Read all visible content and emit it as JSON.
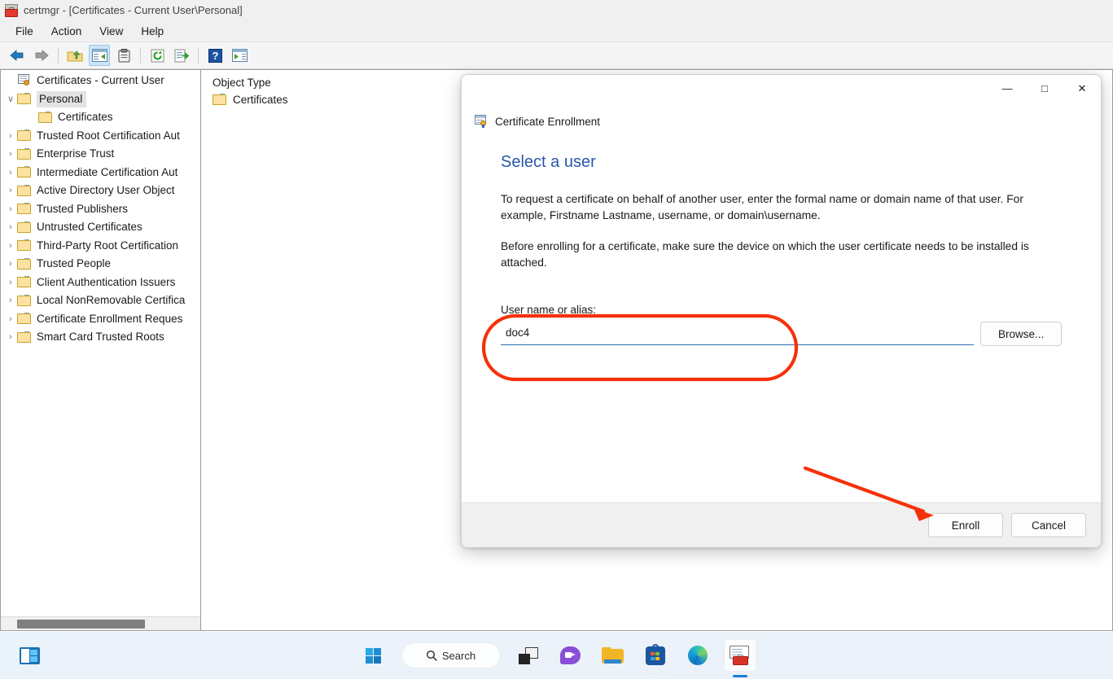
{
  "window": {
    "title": "certmgr - [Certificates - Current User\\Personal]",
    "icon": "certmgr-toolbox-icon",
    "menu": [
      "File",
      "Action",
      "View",
      "Help"
    ],
    "toolbar_buttons": [
      {
        "name": "back-arrow-icon",
        "label": "Back"
      },
      {
        "name": "forward-arrow-icon",
        "label": "Forward"
      },
      {
        "name": "up-one-level-icon",
        "label": "Up One Level"
      },
      {
        "name": "show-hide-console-tree-icon",
        "label": "Show/Hide Console Tree"
      },
      {
        "name": "properties-icon",
        "label": "Properties"
      },
      {
        "name": "refresh-icon",
        "label": "Refresh"
      },
      {
        "name": "export-list-icon",
        "label": "Export List"
      },
      {
        "name": "help-icon",
        "label": "Help"
      },
      {
        "name": "show-action-pane-icon",
        "label": "Show/Hide Action Pane"
      }
    ]
  },
  "tree": {
    "root": "Certificates - Current User",
    "items": [
      {
        "label": "Personal",
        "indent": 1,
        "expanded": true,
        "selected": true,
        "chevron": "∨"
      },
      {
        "label": "Certificates",
        "indent": 2,
        "expanded": false,
        "selected": false,
        "chevron": ""
      },
      {
        "label": "Trusted Root Certification Aut",
        "indent": 1,
        "expanded": false,
        "selected": false,
        "chevron": "›"
      },
      {
        "label": "Enterprise Trust",
        "indent": 1,
        "expanded": false,
        "selected": false,
        "chevron": "›"
      },
      {
        "label": "Intermediate Certification Aut",
        "indent": 1,
        "expanded": false,
        "selected": false,
        "chevron": "›"
      },
      {
        "label": "Active Directory User Object",
        "indent": 1,
        "expanded": false,
        "selected": false,
        "chevron": "›"
      },
      {
        "label": "Trusted Publishers",
        "indent": 1,
        "expanded": false,
        "selected": false,
        "chevron": "›"
      },
      {
        "label": "Untrusted Certificates",
        "indent": 1,
        "expanded": false,
        "selected": false,
        "chevron": "›"
      },
      {
        "label": "Third-Party Root Certification",
        "indent": 1,
        "expanded": false,
        "selected": false,
        "chevron": "›"
      },
      {
        "label": "Trusted People",
        "indent": 1,
        "expanded": false,
        "selected": false,
        "chevron": "›"
      },
      {
        "label": "Client Authentication Issuers",
        "indent": 1,
        "expanded": false,
        "selected": false,
        "chevron": "›"
      },
      {
        "label": "Local NonRemovable Certifica",
        "indent": 1,
        "expanded": false,
        "selected": false,
        "chevron": "›"
      },
      {
        "label": "Certificate Enrollment Reques",
        "indent": 1,
        "expanded": false,
        "selected": false,
        "chevron": "›"
      },
      {
        "label": "Smart Card Trusted Roots",
        "indent": 1,
        "expanded": false,
        "selected": false,
        "chevron": "›"
      }
    ]
  },
  "list": {
    "column_header": "Object Type",
    "rows": [
      {
        "label": "Certificates"
      }
    ]
  },
  "dialog": {
    "app_title": "Certificate Enrollment",
    "heading": "Select a user",
    "paragraphs": [
      "To request a certificate on behalf of another user, enter the formal name or domain name of that user. For example, Firstname Lastname, username, or domain\\username.",
      "Before enrolling for a certificate, make sure the device on which the user certificate needs to be installed is attached."
    ],
    "field": {
      "label": "User name or alias:",
      "value": "doc4",
      "placeholder": ""
    },
    "browse_label": "Browse...",
    "enroll_label": "Enroll",
    "cancel_label": "Cancel",
    "window_controls": {
      "minimize": "—",
      "maximize": "□",
      "close": "✕"
    }
  },
  "annotations": {
    "highlight_color": "#f5310a",
    "ellipse_target": "User name or alias field",
    "arrow_target": "Enroll button"
  },
  "taskbar": {
    "left_icon": "widgets-icon",
    "search_label": "Search",
    "items": [
      {
        "name": "start-button",
        "label": "Start"
      },
      {
        "name": "search-button",
        "label": "Search"
      },
      {
        "name": "task-view-button",
        "label": "Task View"
      },
      {
        "name": "chat-button",
        "label": "Chat"
      },
      {
        "name": "file-explorer-button",
        "label": "File Explorer"
      },
      {
        "name": "microsoft-store-button",
        "label": "Microsoft Store"
      },
      {
        "name": "edge-browser-button",
        "label": "Microsoft Edge"
      },
      {
        "name": "certmgr-taskbar-button",
        "label": "certmgr"
      }
    ]
  }
}
